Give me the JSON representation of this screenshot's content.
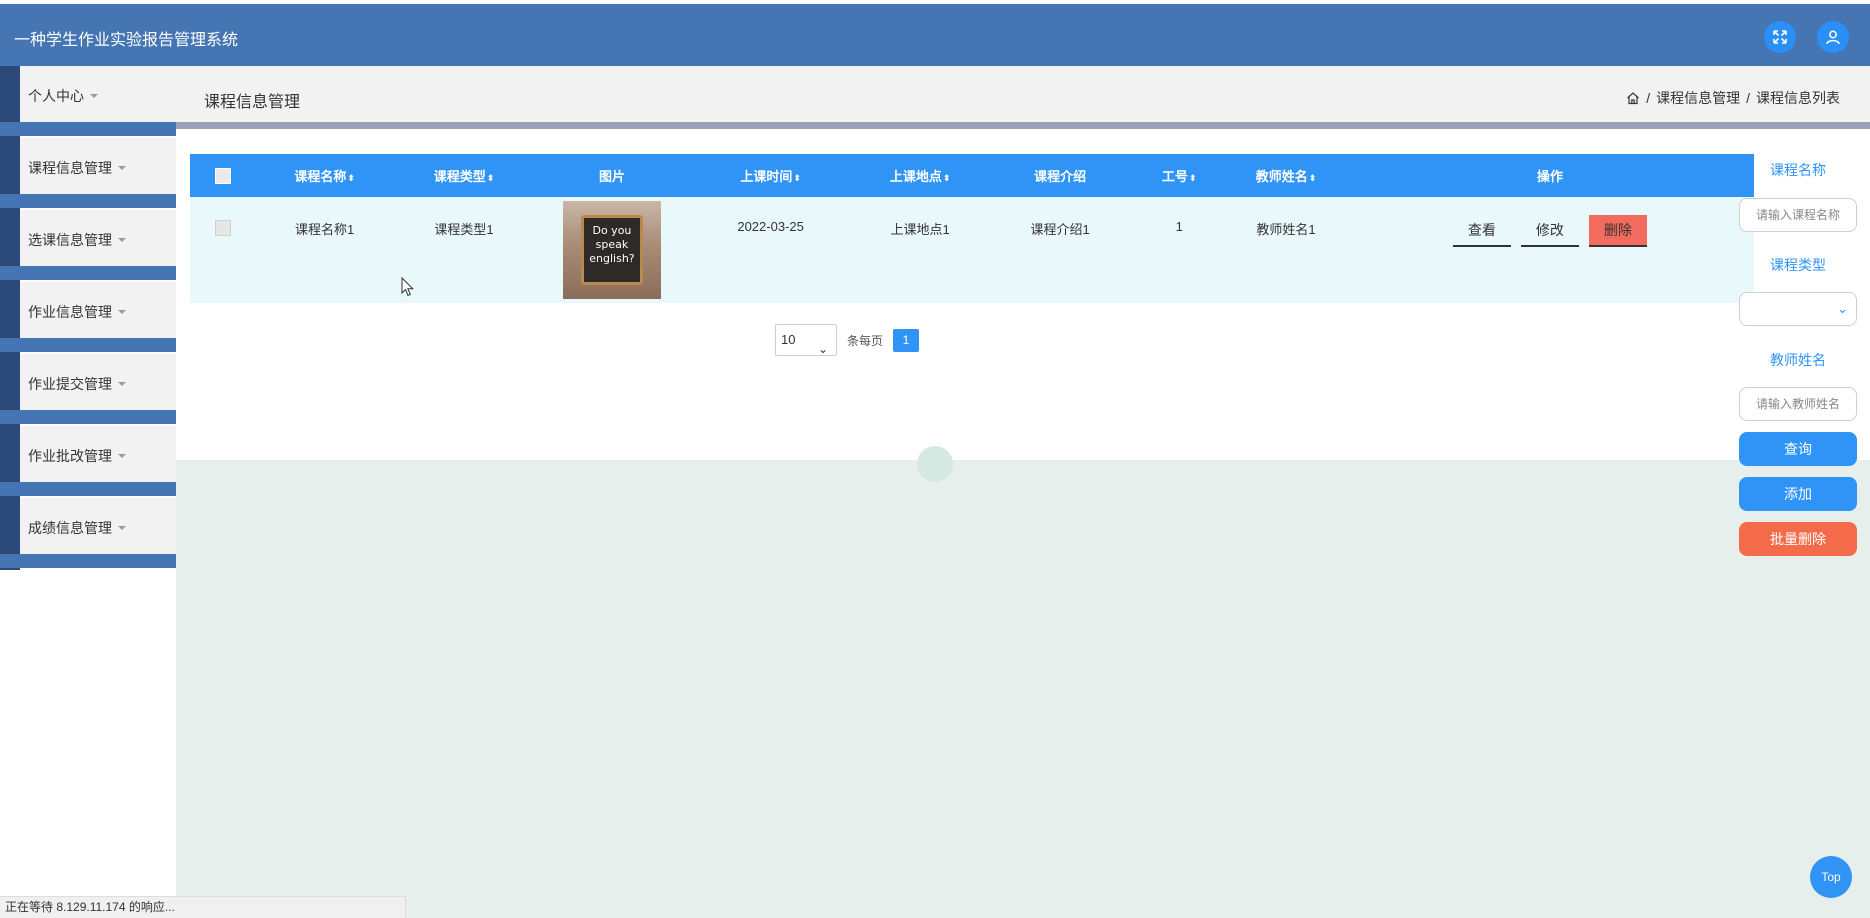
{
  "app": {
    "title": "一种学生作业实验报告管理系统"
  },
  "sidebar": {
    "items": [
      {
        "label": "个人中心"
      },
      {
        "label": "课程信息管理"
      },
      {
        "label": "选课信息管理"
      },
      {
        "label": "作业信息管理"
      },
      {
        "label": "作业提交管理"
      },
      {
        "label": "作业批改管理"
      },
      {
        "label": "成绩信息管理"
      }
    ]
  },
  "header": {
    "title": "课程信息管理",
    "breadcrumb": [
      "课程信息管理",
      "课程信息列表"
    ],
    "separator": "/"
  },
  "table": {
    "columns": [
      "课程名称",
      "课程类型",
      "图片",
      "上课时间",
      "上课地点",
      "课程介绍",
      "工号",
      "教师姓名",
      "操作"
    ],
    "sort_glyph": "⬍",
    "rows": [
      {
        "course_name": "课程名称1",
        "course_type": "课程类型1",
        "image_text": [
          "Do you",
          "speak",
          "english?"
        ],
        "time": "2022-03-25",
        "location": "上课地点1",
        "intro": "课程介绍1",
        "staff_id": "1",
        "teacher": "教师姓名1"
      }
    ],
    "actions": {
      "view": "查看",
      "edit": "修改",
      "delete": "删除"
    }
  },
  "pagination": {
    "page_size": "10",
    "per_page_label": "条每页",
    "current_page": "1"
  },
  "search": {
    "course_name_label": "课程名称",
    "course_name_placeholder": "请输入课程名称",
    "course_type_label": "课程类型",
    "teacher_label": "教师姓名",
    "teacher_placeholder": "请输入教师姓名",
    "query_button": "查询",
    "add_button": "添加",
    "batch_delete_button": "批量删除"
  },
  "fab": {
    "top_label": "Top"
  },
  "status": {
    "text": "正在等待 8.129.11.174 的响应..."
  },
  "colors": {
    "topbar": "#4675b3",
    "accent": "#2f94f6",
    "danger": "#f46b4c",
    "delete": "#f26b5e"
  }
}
